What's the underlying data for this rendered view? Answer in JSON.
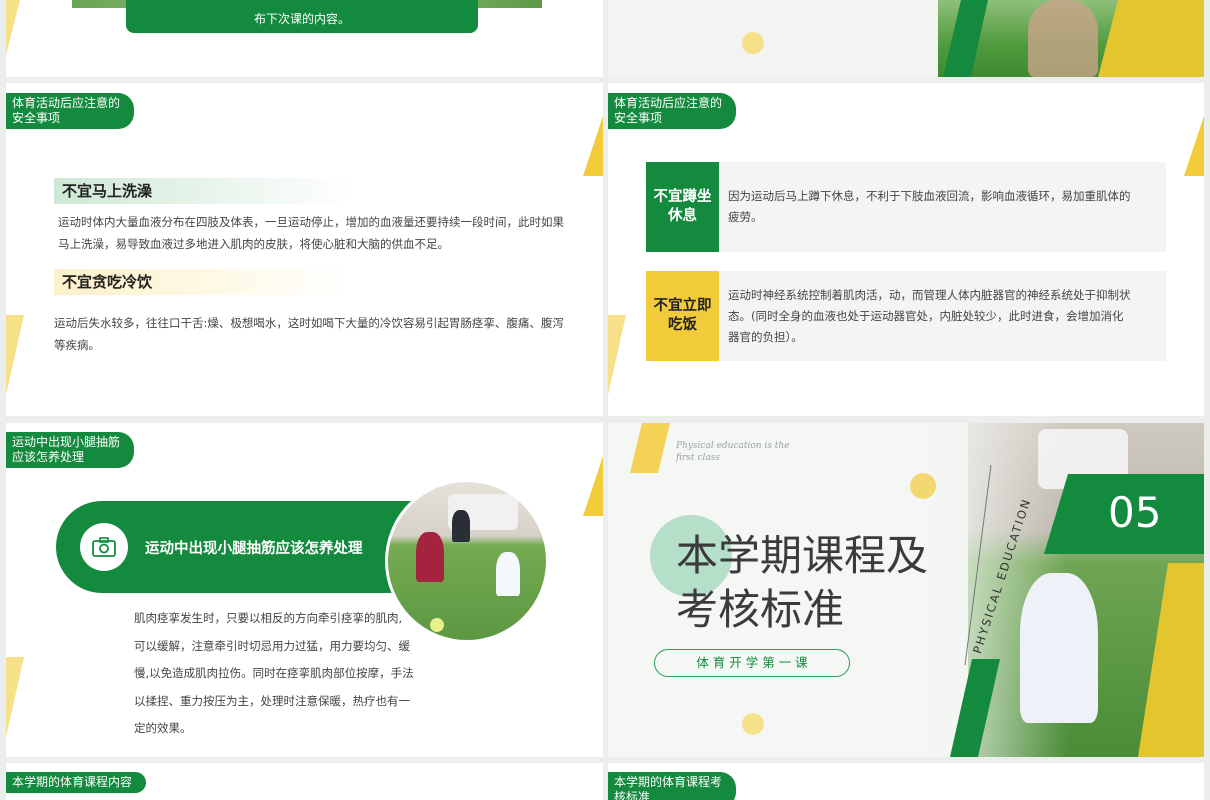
{
  "top_left": {
    "box_text": "布下次课的内容。"
  },
  "slide_a": {
    "tag": [
      "体育活动后应注意的",
      "安全事项"
    ],
    "sections": [
      {
        "heading": "不宜马上洗澡",
        "text": [
          "运动时体内大量血液分布在四肢及体表，一旦运动停止，增加的血液量还要持续一段时间，此时如果",
          "马上洗澡，易导致血液过多地进入肌肉的皮肤，将使心脏和大脑的供血不足。"
        ]
      },
      {
        "heading": "不宜贪吃冷饮",
        "text": [
          "运动后失水较多，往往口干舌:燥、极想喝水，这时如喝下大量的冷饮容易引起胃肠痉挛、腹痛、腹泻",
          "等疾病。"
        ]
      }
    ]
  },
  "slide_b": {
    "tag": [
      "体育活动后应注意的",
      "安全事项"
    ],
    "items": [
      {
        "label": [
          "不宜蹲坐",
          "休息"
        ],
        "color": "#138a3d",
        "text": [
          "因为运动后马上蹲下休息，不利于下肢血液回流，影响血液循环，易加重肌体的",
          "疲劳。"
        ]
      },
      {
        "label": [
          "不宜立即",
          "吃饭"
        ],
        "color": "#f2cb3a",
        "text": [
          "运动时神经系统控制着肌肉活，动，而管理人体内脏器官的神经系统处于抑制状",
          "态。(同时全身的血液也处于运动器官处，内脏处较少，此时进食，会增加消化",
          "器官的负担）。"
        ]
      }
    ]
  },
  "slide_c": {
    "tag": [
      "运动中出现小腿抽筋",
      "应该怎养处理"
    ],
    "banner": "运动中出现小腿抽筋应该怎养处理",
    "icon": "camera-icon",
    "body": [
      "肌肉痉挛发生时，只要以相反的方向牵引痉挛的肌肉,",
      "可以缓解，注意牵引时切忌用力过猛，用力要均匀、缓",
      "慢,以免造成肌肉拉伤。同时在痉挛肌肉部位按摩，手法",
      "以揉捏、重力按压为主，处理时注意保暖，热疗也有一",
      "定的效果。"
    ]
  },
  "slide_d": {
    "small_en": [
      "Physical education is the",
      "first class"
    ],
    "title": [
      "本学期课程及",
      "考核标准"
    ],
    "subtitle": "体 育 开 学 第 一 课",
    "vertical": "PHYSICAL EDUCATION",
    "number": "05"
  },
  "bottom": {
    "left_tag": "本学期的体育课程内容",
    "right_tag": [
      "本学期的体育课程考",
      "核标准"
    ]
  },
  "colors": {
    "green": "#138a3d",
    "yellow": "#f2cb3a",
    "mint": "#a9dbbf"
  }
}
